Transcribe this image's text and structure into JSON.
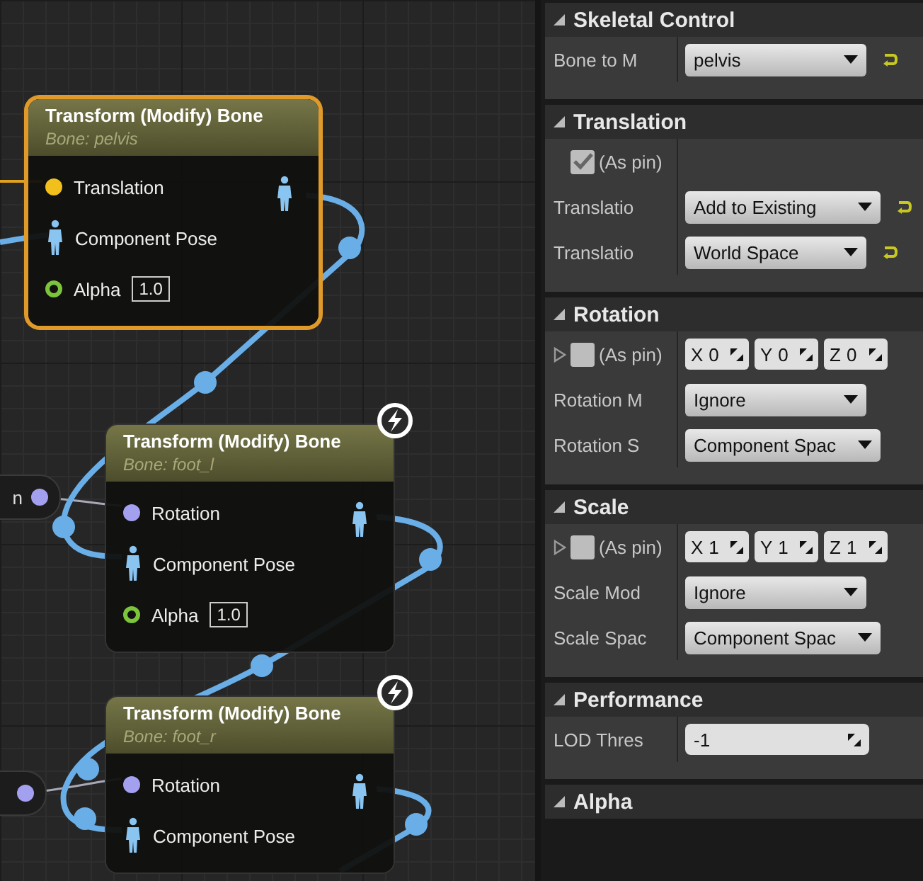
{
  "graph": {
    "side_nodes": [
      {
        "label": "n"
      }
    ],
    "nodes": [
      {
        "title": "Transform (Modify) Bone",
        "subtitle": "Bone: pelvis",
        "selected": true,
        "fast_path": false,
        "pins": [
          {
            "kind": "vector",
            "label": "Translation"
          },
          {
            "kind": "pose",
            "label": "Component Pose"
          },
          {
            "kind": "float",
            "label": "Alpha",
            "value": "1.0"
          }
        ]
      },
      {
        "title": "Transform (Modify) Bone",
        "subtitle": "Bone: foot_l",
        "selected": false,
        "fast_path": true,
        "pins": [
          {
            "kind": "rotator",
            "label": "Rotation"
          },
          {
            "kind": "pose",
            "label": "Component Pose"
          },
          {
            "kind": "float",
            "label": "Alpha",
            "value": "1.0"
          }
        ]
      },
      {
        "title": "Transform (Modify) Bone",
        "subtitle": "Bone: foot_r",
        "selected": false,
        "fast_path": true,
        "pins": [
          {
            "kind": "rotator",
            "label": "Rotation"
          },
          {
            "kind": "pose",
            "label": "Component Pose"
          }
        ]
      }
    ]
  },
  "details": {
    "sections": [
      {
        "title": "Skeletal Control",
        "expanded": true,
        "rows": [
          {
            "kind": "dropdown",
            "label": "Bone to M",
            "value": "pelvis",
            "reset": true
          }
        ]
      },
      {
        "title": "Translation",
        "expanded": true,
        "rows": [
          {
            "kind": "pin",
            "label": "(As pin)",
            "checked": true
          },
          {
            "kind": "dropdown",
            "label": "Translatio",
            "value": "Add to Existing",
            "reset": true
          },
          {
            "kind": "dropdown",
            "label": "Translatio",
            "value": "World Space",
            "reset": true
          }
        ]
      },
      {
        "title": "Rotation",
        "expanded": true,
        "rows": [
          {
            "kind": "pin",
            "label": "(As pin)",
            "checked": false,
            "expanded": false,
            "fields": [
              {
                "axis": "X",
                "value": "0"
              },
              {
                "axis": "Y",
                "value": "0"
              },
              {
                "axis": "Z",
                "value": "0"
              }
            ]
          },
          {
            "kind": "dropdown",
            "label": "Rotation M",
            "value": "Ignore",
            "reset": false
          },
          {
            "kind": "dropdown",
            "label": "Rotation S",
            "value": "Component Spac",
            "reset": false
          }
        ]
      },
      {
        "title": "Scale",
        "expanded": true,
        "rows": [
          {
            "kind": "pin",
            "label": "(As pin)",
            "checked": false,
            "expanded": false,
            "fields": [
              {
                "axis": "X",
                "value": "1"
              },
              {
                "axis": "Y",
                "value": "1"
              },
              {
                "axis": "Z",
                "value": "1"
              }
            ]
          },
          {
            "kind": "dropdown",
            "label": "Scale Mod",
            "value": "Ignore",
            "reset": false
          },
          {
            "kind": "dropdown",
            "label": "Scale Spac",
            "value": "Component Spac",
            "reset": false
          }
        ]
      },
      {
        "title": "Performance",
        "expanded": true,
        "rows": [
          {
            "kind": "number",
            "label": "LOD Thres",
            "value": "-1"
          }
        ]
      },
      {
        "title": "Alpha",
        "expanded": true
      }
    ]
  }
}
